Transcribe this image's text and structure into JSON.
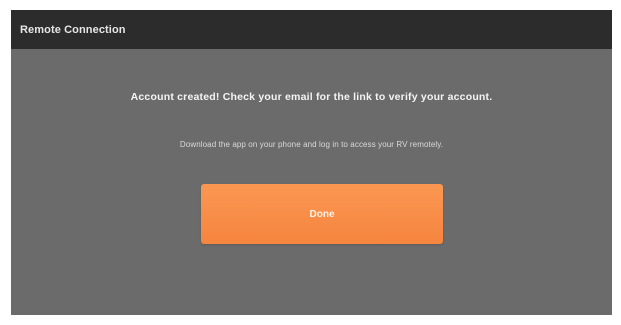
{
  "window": {
    "title": "Remote Connection"
  },
  "message": {
    "headline": "Account created! Check your email for the link to verify your account.",
    "subtext": "Download the app on your phone and log in to access your RV remotely."
  },
  "actions": {
    "done_label": "Done"
  },
  "colors": {
    "header_bg": "#2c2c2c",
    "panel_bg": "#6b6b6b",
    "accent": "#f78b45"
  }
}
